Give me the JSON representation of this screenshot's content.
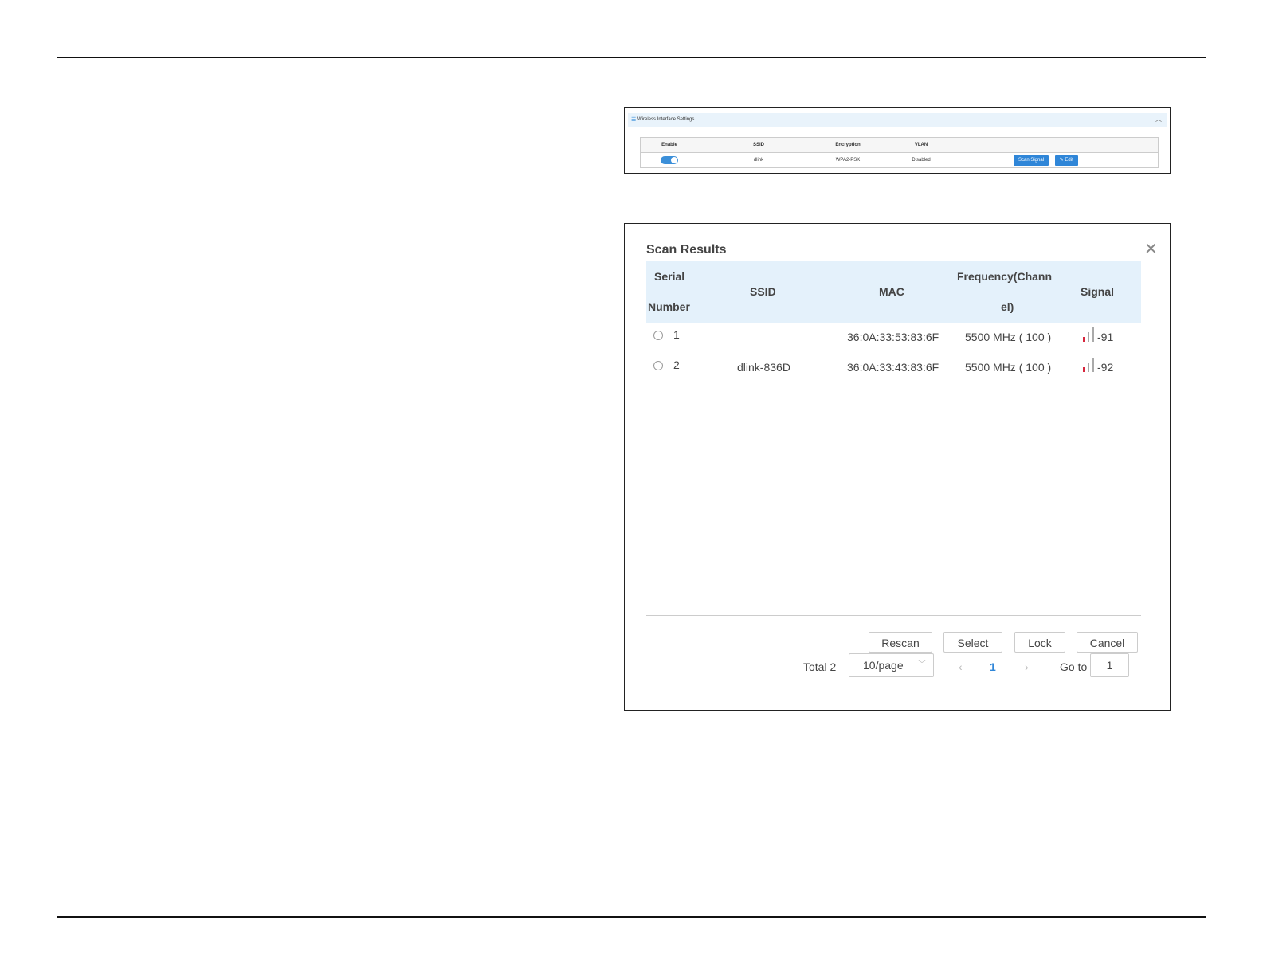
{
  "wireless_panel": {
    "title": "Wireless Interface Settings",
    "columns": [
      "Enable",
      "SSID",
      "Encryption",
      "VLAN"
    ],
    "row": {
      "enabled": true,
      "ssid": "dlink",
      "encryption": "WPA2-PSK",
      "vlan": "Disabled",
      "scan_button": "Scan Signal",
      "edit_button": "Edit"
    }
  },
  "scan_dialog": {
    "title": "Scan Results",
    "columns": {
      "serial_line1": "Serial",
      "serial_line2": "Number",
      "ssid": "SSID",
      "mac": "MAC",
      "freq_line1": "Frequency(Chann",
      "freq_line2": "el)",
      "signal": "Signal"
    },
    "rows": [
      {
        "serial": "1",
        "ssid": "",
        "mac": "36:0A:33:53:83:6F",
        "frequency": "5500 MHz ( 100 )",
        "signal": "-91",
        "signal_bars": 1
      },
      {
        "serial": "2",
        "ssid": "dlink-836D",
        "mac": "36:0A:33:43:83:6F",
        "frequency": "5500 MHz ( 100 )",
        "signal": "-92",
        "signal_bars": 1
      }
    ],
    "buttons": {
      "rescan": "Rescan",
      "select": "Select",
      "lock": "Lock",
      "cancel": "Cancel"
    },
    "pagination": {
      "total": "Total 2",
      "page_size": "10/page",
      "current_page": "1",
      "goto_label": "Go to",
      "goto_value": "1"
    }
  },
  "colors": {
    "accent": "#2f86d8",
    "header_bg": "#e4f1fb",
    "signal_low": "#d7263d"
  }
}
